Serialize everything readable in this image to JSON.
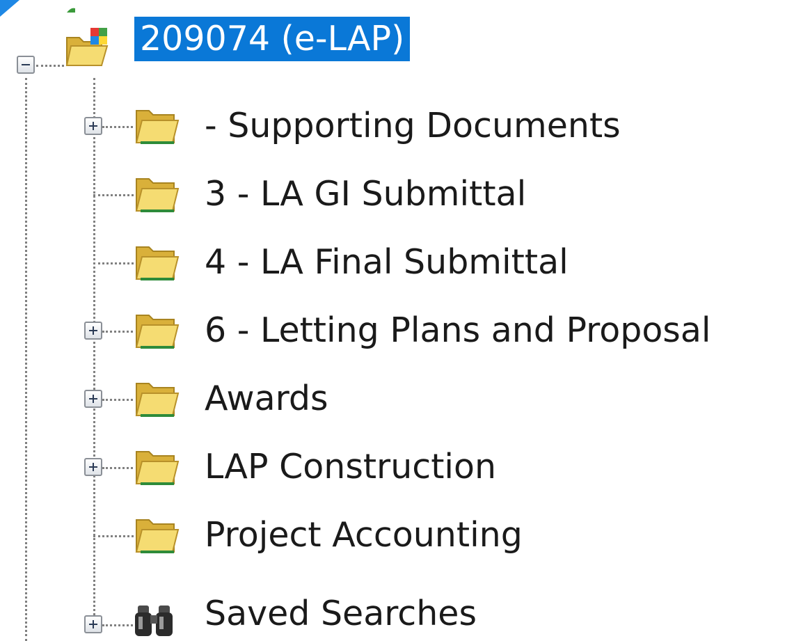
{
  "tree": {
    "root": {
      "label": "209074 (e-LAP)",
      "icon": "project-folder-icon",
      "expanded": true,
      "selected": true
    },
    "children": [
      {
        "label": "- Supporting Documents",
        "icon": "folder-icon",
        "expandable": true
      },
      {
        "label": "3 - LA GI Submittal",
        "icon": "folder-icon",
        "expandable": false
      },
      {
        "label": "4 - LA Final Submittal",
        "icon": "folder-icon",
        "expandable": false
      },
      {
        "label": "6 - Letting Plans and Proposal",
        "icon": "folder-icon",
        "expandable": true
      },
      {
        "label": "Awards",
        "icon": "folder-icon",
        "expandable": true
      },
      {
        "label": "LAP Construction",
        "icon": "folder-icon",
        "expandable": true
      },
      {
        "label": "Project Accounting",
        "icon": "folder-icon",
        "expandable": false
      },
      {
        "label": "Saved Searches",
        "icon": "binoculars-icon",
        "expandable": true
      }
    ]
  },
  "colors": {
    "selection": "#0a78d7",
    "folder": "#f2d25c",
    "connector": "#808080"
  }
}
